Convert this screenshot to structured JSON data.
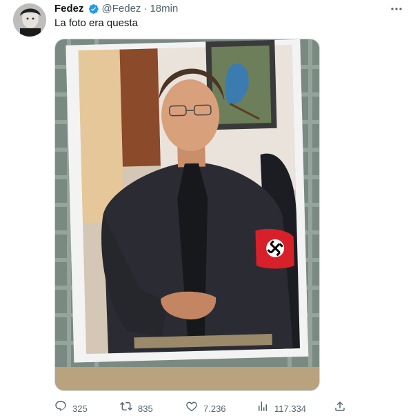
{
  "tweet": {
    "author_name": "Fedez",
    "handle": "@Fedez",
    "separator": "·",
    "time": "18min",
    "text": "La foto era questa",
    "verified": true
  },
  "media": {
    "description_icon": "photo",
    "armband_color": "#d7202a"
  },
  "actions": {
    "replies": "325",
    "retweets": "835",
    "likes": "7.236",
    "views": "117.334"
  },
  "icons": {
    "reply": "reply-icon",
    "retweet": "retweet-icon",
    "like": "heart-icon",
    "views": "views-icon",
    "share": "share-icon",
    "more": "more-icon",
    "verified": "verified-badge-icon"
  },
  "colors": {
    "accent": "#1d9bf0",
    "text": "#0f1419",
    "secondary": "#536471"
  }
}
